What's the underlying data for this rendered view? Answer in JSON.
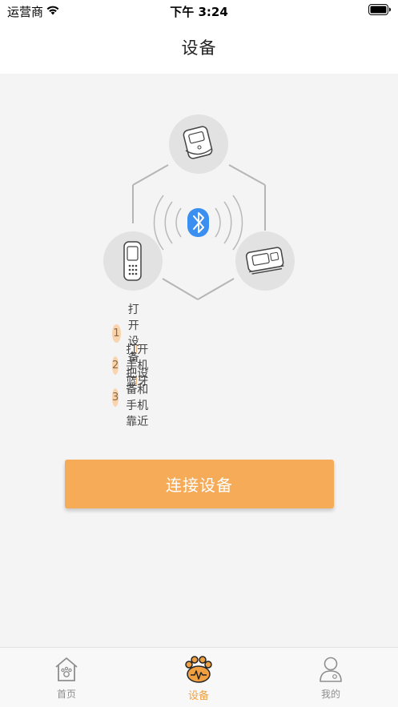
{
  "status_bar": {
    "carrier": "运营商",
    "time": "下午 3:24"
  },
  "nav": {
    "title": "设备"
  },
  "steps": [
    {
      "num": "1",
      "text": "打开设备"
    },
    {
      "num": "2",
      "text": "打开手机蓝牙"
    },
    {
      "num": "3",
      "text": "把设备和手机靠近"
    }
  ],
  "connect_button": {
    "label": "连接设备"
  },
  "tabs": [
    {
      "label": "首页",
      "icon": "house-icon",
      "active": false
    },
    {
      "label": "设备",
      "icon": "paw-icon",
      "active": true
    },
    {
      "label": "我的",
      "icon": "person-icon",
      "active": false
    }
  ],
  "colors": {
    "accent": "#f6ab59",
    "tab_active": "#f0a040",
    "bluetooth": "#3b8ff0",
    "step_badge": "#f9d3ab",
    "background": "#f4f4f4"
  }
}
